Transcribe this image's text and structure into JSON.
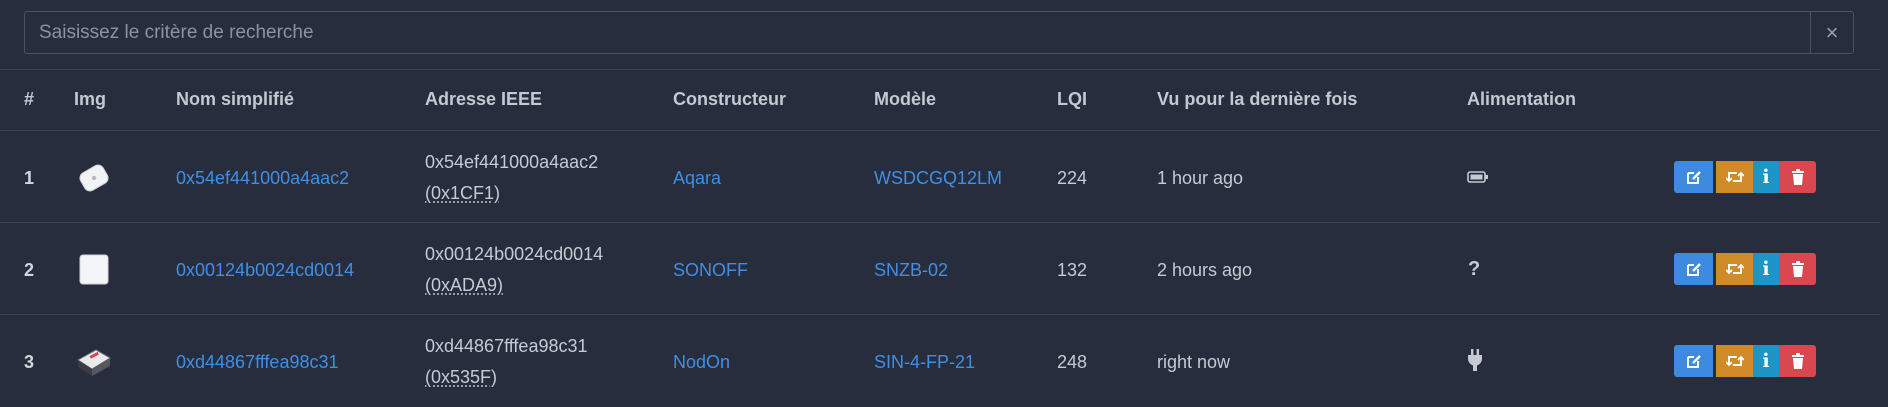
{
  "search": {
    "placeholder": "Saisissez le critère de recherche",
    "clear_label": "×"
  },
  "table": {
    "headers": [
      "#",
      "Img",
      "Nom simplifié",
      "Adresse IEEE",
      "Constructeur",
      "Modèle",
      "LQI",
      "Vu pour la dernière fois",
      "Alimentation"
    ],
    "rows": [
      {
        "index": "1",
        "image_icon": "aqara-sensor-image",
        "friendly_name": "0x54ef441000a4aac2",
        "ieee": "0x54ef441000a4aac2",
        "nwk": "(0x1CF1)",
        "manufacturer": "Aqara",
        "model": "WSDCGQ12LM",
        "lqi": "224",
        "last_seen": "1 hour ago",
        "power_icon": "battery-icon",
        "power_text": ""
      },
      {
        "index": "2",
        "image_icon": "sonoff-sensor-image",
        "friendly_name": "0x00124b0024cd0014",
        "ieee": "0x00124b0024cd0014",
        "nwk": "(0xADA9)",
        "manufacturer": "SONOFF",
        "model": "SNZB-02",
        "lqi": "132",
        "last_seen": "2 hours ago",
        "power_icon": "unknown-icon",
        "power_text": "?"
      },
      {
        "index": "3",
        "image_icon": "nodon-module-image",
        "friendly_name": "0xd44867fffea98c31",
        "ieee": "0xd44867fffea98c31",
        "nwk": "(0x535F)",
        "manufacturer": "NodOn",
        "model": "SIN-4-FP-21",
        "lqi": "248",
        "last_seen": "right now",
        "power_icon": "plug-icon",
        "power_text": ""
      }
    ]
  },
  "actions": {
    "info_label": "i"
  },
  "colors": {
    "background": "#272d3d",
    "link": "#3f8fe6",
    "edit": "#3d8ae0",
    "swap": "#d08a2a",
    "info": "#1d95c7",
    "delete": "#d9474f"
  }
}
